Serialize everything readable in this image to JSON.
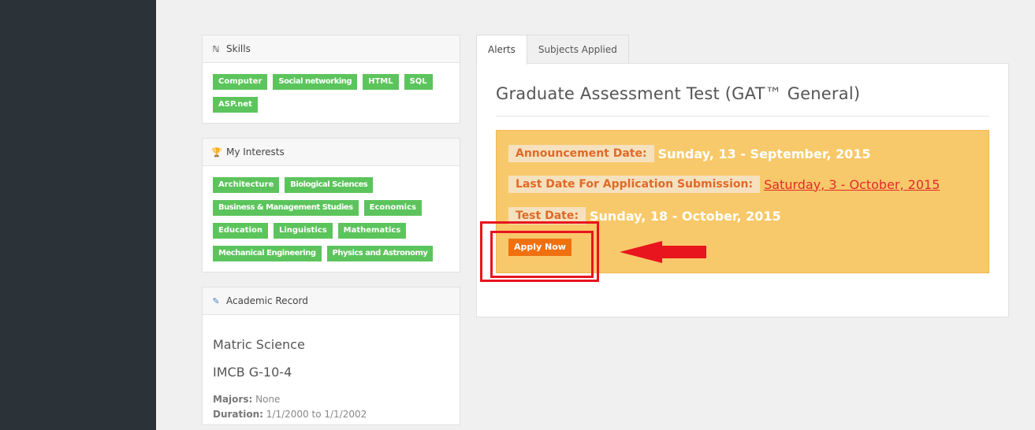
{
  "skills": {
    "title": "Skills",
    "icon": "skills-icon",
    "tags": [
      "Computer",
      "Social networking",
      "HTML",
      "SQL",
      "ASP.net"
    ]
  },
  "interests": {
    "title": "My Interests",
    "icon": "trophy-icon",
    "tags": [
      "Architecture",
      "Biological Sciences",
      "Business & Management Studies",
      "Economics",
      "Education",
      "Linguistics",
      "Mathematics",
      "Mechanical Engineering",
      "Physics and Astronomy"
    ]
  },
  "academic": {
    "title": "Academic Record",
    "icon": "pencil-icon",
    "degree": "Matric Science",
    "institution": "IMCB G-10-4",
    "majors_label": "Majors:",
    "majors_value": "None",
    "duration_label": "Duration:",
    "duration_value": "1/1/2000 to 1/1/2002"
  },
  "tabs": [
    "Alerts",
    "Subjects Applied"
  ],
  "alert": {
    "title": "Graduate Assessment Test (GAT™ General)",
    "announcement_label": "Announcement Date:",
    "announcement_value": "Sunday, 13 - September, 2015",
    "last_date_label": "Last Date For Application Submission:",
    "last_date_value": "Saturday, 3 - October, 2015",
    "test_date_label": "Test Date:",
    "test_date_value": "Sunday, 18 - October, 2015",
    "apply_label": "Apply Now"
  },
  "colors": {
    "sidebar": "#2b3238",
    "tag_green": "#5cc45c",
    "alert_bg": "#f8c96a",
    "apply_orange": "#f07010",
    "highlight_red": "#e8141e"
  }
}
